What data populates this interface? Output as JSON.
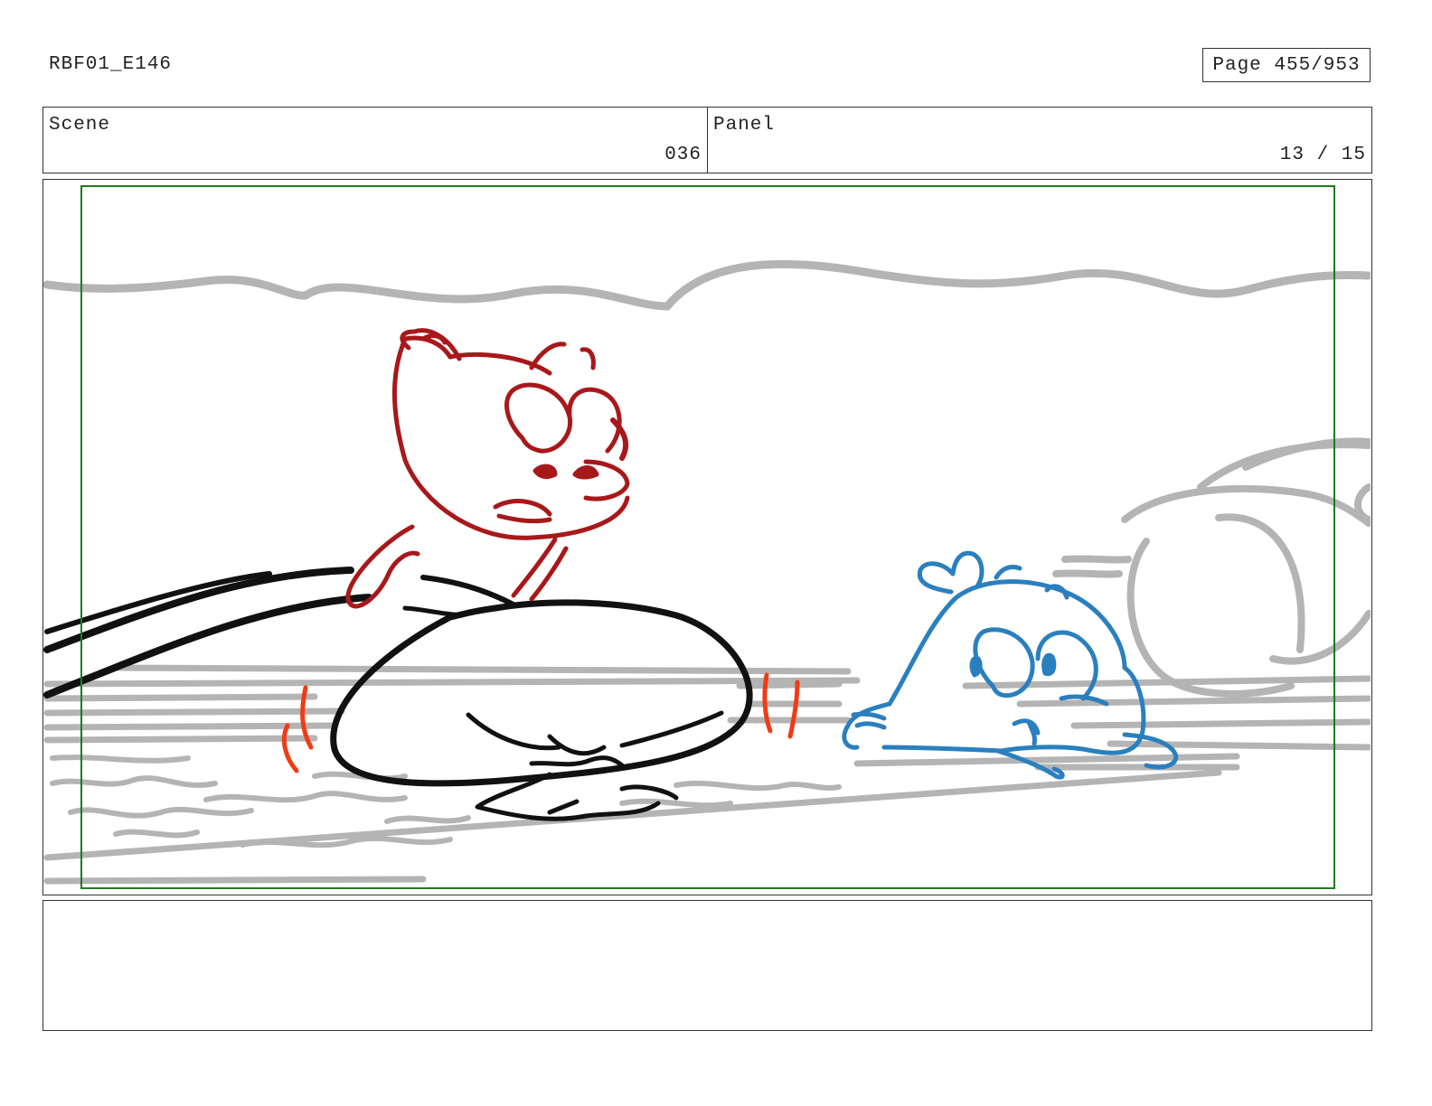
{
  "header": {
    "doc_id": "RBF01_E146",
    "page_label": "Page 455/953"
  },
  "info": {
    "scene_label": "Scene",
    "scene_value": "036",
    "panel_label": "Panel",
    "panel_value": "13 / 15"
  },
  "drawing": {
    "colors": {
      "background_lines": "#b4b4b4",
      "safe_frame": "#1f7a1f",
      "red_character": "#a8181a",
      "motion_marks": "#f03c14",
      "blue_character": "#2a7fbf",
      "ink": "#111111"
    }
  },
  "notes": {
    "text": ""
  }
}
